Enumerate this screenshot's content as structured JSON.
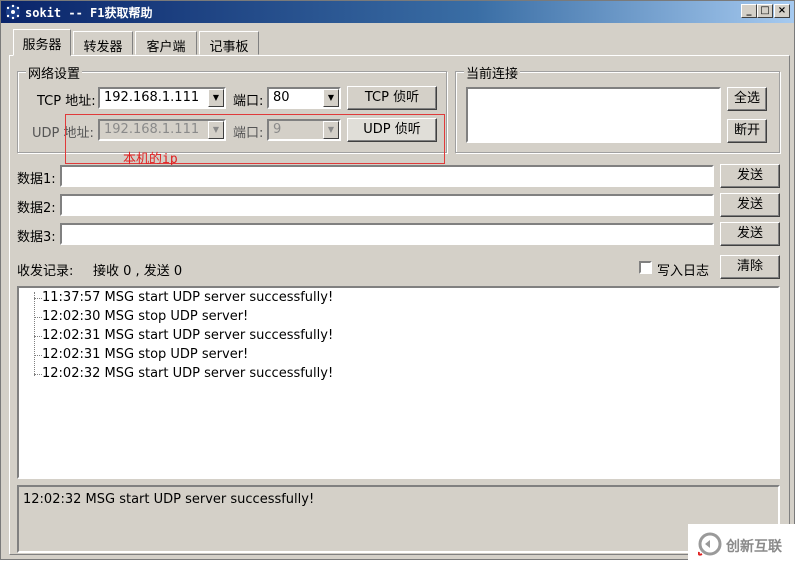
{
  "window": {
    "title": "sokit -- F1获取帮助",
    "controls": {
      "minimize": "_",
      "maximize": "□",
      "close": "×"
    }
  },
  "tabs": [
    {
      "label": "服务器",
      "active": true
    },
    {
      "label": "转发器",
      "active": false
    },
    {
      "label": "客户端",
      "active": false
    },
    {
      "label": "记事板",
      "active": false
    }
  ],
  "network": {
    "title": "网络设置",
    "tcp": {
      "label": "TCP 地址:",
      "address": "192.168.1.111",
      "port_label": "端口:",
      "port": "80",
      "button": "TCP 侦听"
    },
    "udp": {
      "label": "UDP 地址:",
      "address": "192.168.1.111",
      "port_label": "端口:",
      "port": "9",
      "button": "UDP 侦听"
    }
  },
  "connections": {
    "title": "当前连接",
    "select_all": "全选",
    "disconnect": "断开"
  },
  "annotation": {
    "text": "本机的ip",
    "color": "#e02020"
  },
  "data_rows": [
    {
      "label": "数据1:",
      "value": "",
      "send": "发送"
    },
    {
      "label": "数据2:",
      "value": "",
      "send": "发送"
    },
    {
      "label": "数据3:",
      "value": "",
      "send": "发送"
    }
  ],
  "records": {
    "label": "收发记录:",
    "stats": "接收 0 , 发送 0",
    "log_to_file": "写入日志",
    "log_checked": false,
    "clear": "清除"
  },
  "log": [
    "11:37:57 MSG start UDP server successfully!",
    "12:02:30 MSG stop UDP server!",
    "12:02:31 MSG start UDP server successfully!",
    "12:02:31 MSG stop UDP server!",
    "12:02:32 MSG start UDP server successfully!"
  ],
  "status": {
    "text": "12:02:32 MSG start UDP server successfully!"
  },
  "watermark": {
    "text": "创新互联"
  }
}
